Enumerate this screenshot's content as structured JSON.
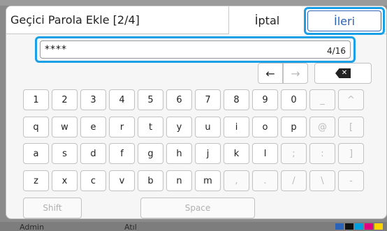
{
  "dialog": {
    "title": "Geçici Parola Ekle [2/4]",
    "cancel_label": "İptal",
    "next_label": "İleri"
  },
  "input": {
    "value": "****",
    "counter": "4/16"
  },
  "nav": {
    "left_arrow": "←",
    "right_arrow": "→",
    "backspace_glyph": "✕"
  },
  "keyboard": {
    "rows": [
      [
        {
          "label": "1",
          "enabled": true
        },
        {
          "label": "2",
          "enabled": true
        },
        {
          "label": "3",
          "enabled": true
        },
        {
          "label": "4",
          "enabled": true
        },
        {
          "label": "5",
          "enabled": true
        },
        {
          "label": "6",
          "enabled": true
        },
        {
          "label": "7",
          "enabled": true
        },
        {
          "label": "8",
          "enabled": true
        },
        {
          "label": "9",
          "enabled": true
        },
        {
          "label": "0",
          "enabled": true
        },
        {
          "label": "_",
          "enabled": false
        },
        {
          "label": "^",
          "enabled": false
        }
      ],
      [
        {
          "label": "q",
          "enabled": true
        },
        {
          "label": "w",
          "enabled": true
        },
        {
          "label": "e",
          "enabled": true
        },
        {
          "label": "r",
          "enabled": true
        },
        {
          "label": "t",
          "enabled": true
        },
        {
          "label": "y",
          "enabled": true
        },
        {
          "label": "u",
          "enabled": true
        },
        {
          "label": "i",
          "enabled": true
        },
        {
          "label": "o",
          "enabled": true
        },
        {
          "label": "p",
          "enabled": true
        },
        {
          "label": "@",
          "enabled": false
        },
        {
          "label": "[",
          "enabled": false
        }
      ],
      [
        {
          "label": "a",
          "enabled": true
        },
        {
          "label": "s",
          "enabled": true
        },
        {
          "label": "d",
          "enabled": true
        },
        {
          "label": "f",
          "enabled": true
        },
        {
          "label": "g",
          "enabled": true
        },
        {
          "label": "h",
          "enabled": true
        },
        {
          "label": "j",
          "enabled": true
        },
        {
          "label": "k",
          "enabled": true
        },
        {
          "label": "l",
          "enabled": true
        },
        {
          "label": ";",
          "enabled": false
        },
        {
          "label": ":",
          "enabled": false
        },
        {
          "label": "]",
          "enabled": false
        }
      ],
      [
        {
          "label": "z",
          "enabled": true
        },
        {
          "label": "x",
          "enabled": true
        },
        {
          "label": "c",
          "enabled": true
        },
        {
          "label": "v",
          "enabled": true
        },
        {
          "label": "b",
          "enabled": true
        },
        {
          "label": "n",
          "enabled": true
        },
        {
          "label": "m",
          "enabled": true
        },
        {
          "label": ",",
          "enabled": false
        },
        {
          "label": ".",
          "enabled": false
        },
        {
          "label": "/",
          "enabled": false
        },
        {
          "label": "\\",
          "enabled": false
        },
        {
          "label": "-",
          "enabled": false
        }
      ]
    ],
    "shift_label": "Shift",
    "space_label": "Space"
  },
  "background": {
    "bottom_left": "Admin",
    "bottom_mid": "Atıl",
    "swatch_colors": [
      "#2b63b8",
      "#111111",
      "#00a0e0",
      "#e0007f",
      "#ffd200"
    ]
  },
  "colors": {
    "focus": "#1aa0e6",
    "primary": "#2b63b8"
  }
}
